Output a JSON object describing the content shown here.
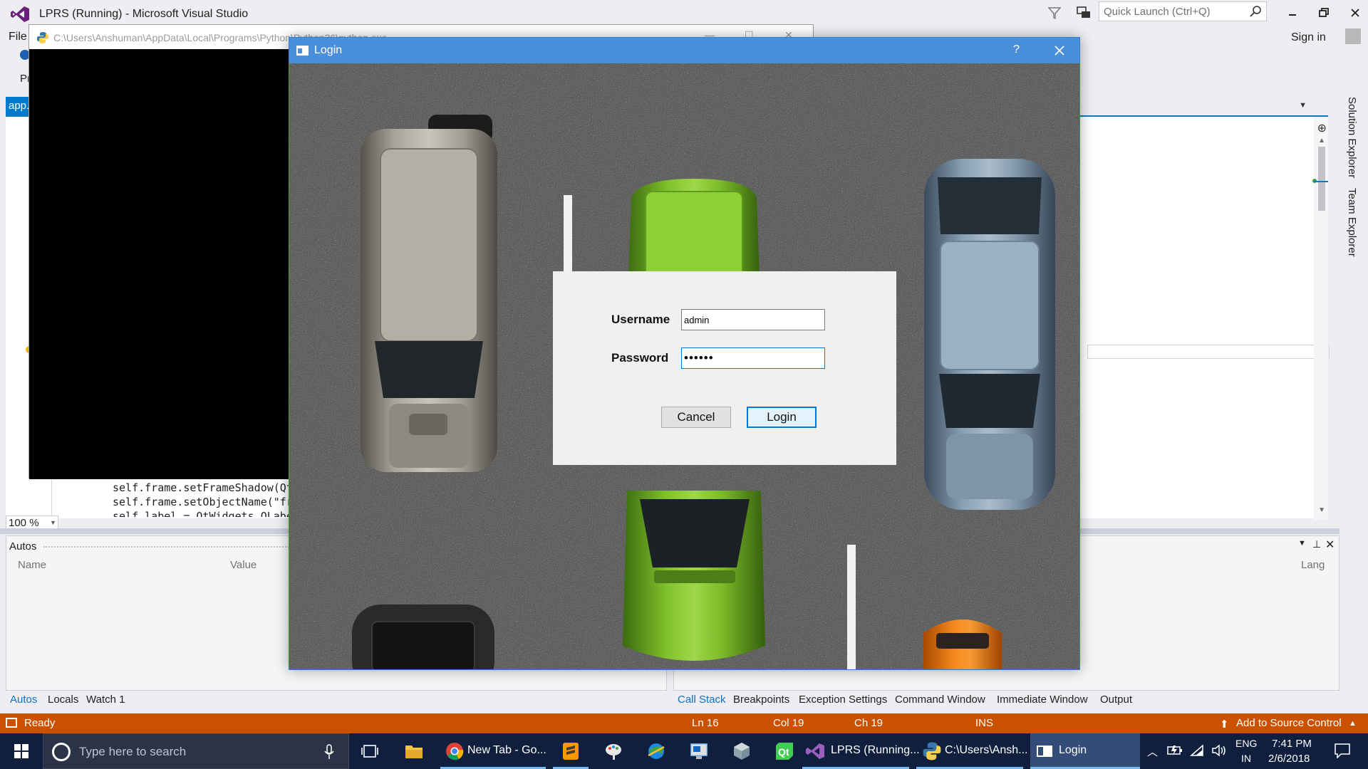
{
  "vs": {
    "title": "LPRS (Running) - Microsoft Visual Studio",
    "quick_launch_placeholder": "Quick Launch (Ctrl+Q)",
    "sign_in": "Sign in",
    "menu_file": "File",
    "toolbar_fragment": "Pr",
    "doc_tab": "app.py",
    "code_lines": [
      "self.frame.setFrameShadow(QtW",
      "self.frame.setObjectName(\"fr",
      "self.label = QtWidgets.QLabe"
    ],
    "zoom": "100 %",
    "side_tabs": [
      "Solution Explorer",
      "Team Explorer"
    ],
    "autos": {
      "title": "Autos",
      "columns": [
        "Name",
        "Value"
      ]
    },
    "callstack": {
      "columns": [
        "Lang"
      ]
    },
    "bottom_tabs_left": [
      "Autos",
      "Locals",
      "Watch 1"
    ],
    "bottom_tabs_right": [
      "Call Stack",
      "Breakpoints",
      "Exception Settings",
      "Command Window",
      "Immediate Window",
      "Output"
    ],
    "status": {
      "text": "Ready",
      "ln": "Ln 16",
      "col": "Col 19",
      "ch": "Ch 19",
      "ins": "INS",
      "source_control": "Add to Source Control"
    },
    "colors": {
      "accent": "#007acc",
      "status_bar": "#ca5100"
    }
  },
  "console": {
    "title": "C:\\Users\\Anshuman\\AppData\\Local\\Programs\\Python\\Python36\\python.exe"
  },
  "login": {
    "title": "Login",
    "help": "?",
    "username_label": "Username",
    "username_value": "admin",
    "password_label": "Password",
    "password_value": "••••••",
    "cancel_label": "Cancel",
    "login_label": "Login",
    "colors": {
      "titlebar": "#4a8fdc",
      "focus": "#0078d7"
    }
  },
  "taskbar": {
    "search_placeholder": "Type here to search",
    "apps": [
      {
        "name": "file-explorer",
        "label": ""
      },
      {
        "name": "chrome",
        "label": "New Tab - Go..."
      },
      {
        "name": "sublime-text",
        "label": ""
      },
      {
        "name": "paint",
        "label": ""
      },
      {
        "name": "network-app",
        "label": ""
      },
      {
        "name": "remote-app",
        "label": ""
      },
      {
        "name": "virtualbox",
        "label": ""
      },
      {
        "name": "qt-designer",
        "label": ""
      },
      {
        "name": "visual-studio",
        "label": "LPRS (Running..."
      },
      {
        "name": "python-console",
        "label": "C:\\Users\\Ansh..."
      },
      {
        "name": "login-window",
        "label": "Login"
      }
    ],
    "tray": {
      "lang_line1": "ENG",
      "lang_line2": "IN",
      "time": "7:41 PM",
      "date": "2/6/2018"
    }
  }
}
